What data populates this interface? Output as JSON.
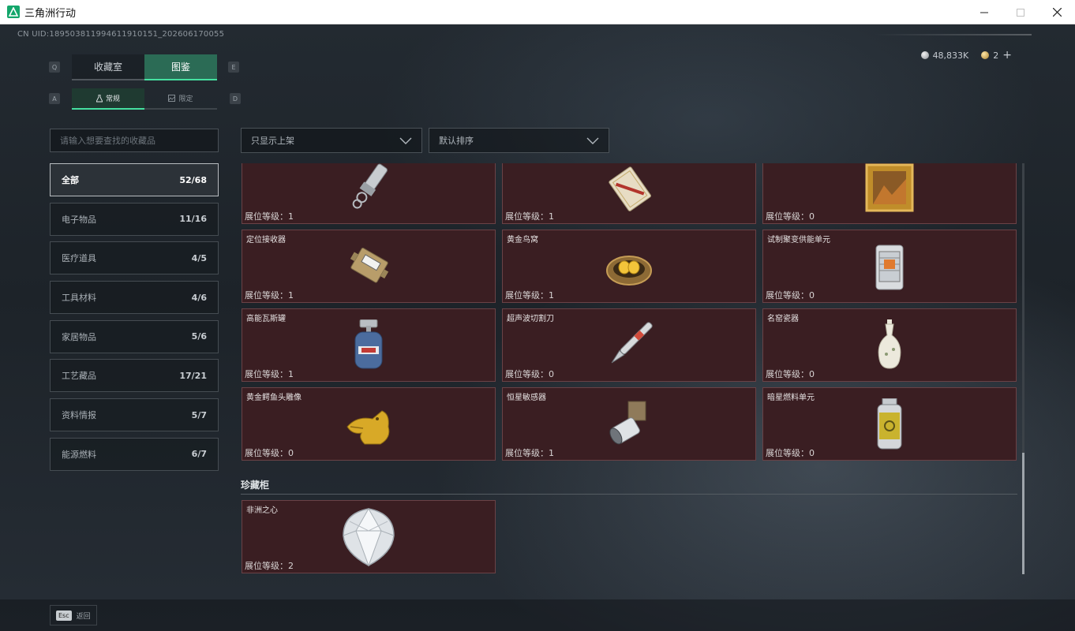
{
  "window": {
    "title": "三角洲行动"
  },
  "uid": "CN UID:189503811994611910151_202606170055",
  "currency": {
    "silver": "48,833K",
    "gold": "2",
    "plus": "+"
  },
  "hints": {
    "q": "Q",
    "e": "E",
    "a": "A",
    "d": "D"
  },
  "main_tabs": [
    {
      "label": "收藏室",
      "active": false
    },
    {
      "label": "图鉴",
      "active": true
    }
  ],
  "sub_tabs": [
    {
      "label": "常规",
      "active": true
    },
    {
      "label": "限定",
      "active": false
    }
  ],
  "search": {
    "placeholder": "请输入想要查找的收藏品"
  },
  "categories": [
    {
      "label": "全部",
      "count": "52/68"
    },
    {
      "label": "电子物品",
      "count": "11/16"
    },
    {
      "label": "医疗道具",
      "count": "4/5"
    },
    {
      "label": "工具材料",
      "count": "4/6"
    },
    {
      "label": "家居物品",
      "count": "5/6"
    },
    {
      "label": "工艺藏品",
      "count": "17/21"
    },
    {
      "label": "资料情报",
      "count": "5/7"
    },
    {
      "label": "能源燃料",
      "count": "6/7"
    }
  ],
  "filters": {
    "show": "只显示上架",
    "sort": "默认排序"
  },
  "items": [
    {
      "name": "",
      "level": "展位等级：1",
      "icon": "flashlight-icon"
    },
    {
      "name": "",
      "level": "展位等级：1",
      "icon": "card-icon"
    },
    {
      "name": "",
      "level": "展位等级：0",
      "icon": "painting-icon"
    },
    {
      "name": "定位接收器",
      "level": "展位等级：1",
      "icon": "receiver-icon"
    },
    {
      "name": "黄金鸟窝",
      "level": "展位等级：1",
      "icon": "golden-nest-icon"
    },
    {
      "name": "试制聚变供能单元",
      "level": "展位等级：0",
      "icon": "fusion-unit-icon"
    },
    {
      "name": "高能瓦斯罐",
      "level": "展位等级：1",
      "icon": "gas-tank-icon"
    },
    {
      "name": "超声波切割刀",
      "level": "展位等级：0",
      "icon": "cutter-icon"
    },
    {
      "name": "名窑瓷器",
      "level": "展位等级：0",
      "icon": "porcelain-vase-icon"
    },
    {
      "name": "黄金鳄鱼头雕像",
      "level": "展位等级：0",
      "icon": "gold-croc-statue-icon"
    },
    {
      "name": "恒星敏感器",
      "level": "展位等级：1",
      "icon": "star-sensor-icon"
    },
    {
      "name": "暗星燃料单元",
      "level": "展位等级：0",
      "icon": "fuel-cell-icon"
    }
  ],
  "cabinet": {
    "title": "珍藏柜",
    "items": [
      {
        "name": "非洲之心",
        "level": "展位等级：2",
        "icon": "diamond-icon"
      }
    ]
  },
  "footer": {
    "esc_key": "Esc",
    "back_label": "返回"
  }
}
